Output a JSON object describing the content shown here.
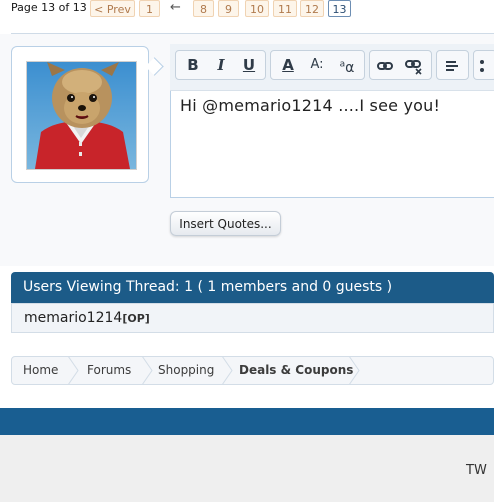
{
  "pagination": {
    "info": "Page 13 of 13",
    "prev": "< Prev",
    "pages": [
      "1",
      "8",
      "9",
      "10",
      "11",
      "12",
      "13"
    ],
    "arrow": "←",
    "current": "13"
  },
  "editor": {
    "text": "Hi @memario1214 ....I see you!",
    "toolbar": {
      "bold": "B",
      "italic": "I",
      "underline": "U",
      "font_color": "A",
      "font_size": "A:",
      "font_family": "a",
      "link": "link-icon",
      "unlink": "unlink-icon",
      "align": "align-icon",
      "more": "more-icon"
    }
  },
  "insert_quotes": "Insert Quotes...",
  "users_viewing": {
    "header": "Users Viewing Thread: 1 ( 1 members and 0 guests )",
    "member": "memario1214",
    "member_tag": "[OP]"
  },
  "breadcrumb": [
    "Home",
    "Forums",
    "Shopping",
    "Deals & Coupons"
  ],
  "footer": {
    "right_text": "TW"
  },
  "colors": {
    "header_blue": "#1c5b88",
    "footer_blue": "#195e91",
    "pager_border": "#f0d3b3"
  }
}
